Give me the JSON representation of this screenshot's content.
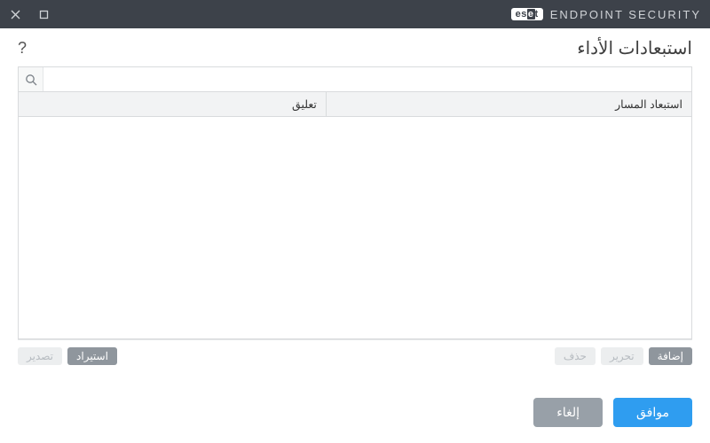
{
  "brand": {
    "badge_html": "eset",
    "product": "ENDPOINT SECURITY"
  },
  "page_title": "استبعادات الأداء",
  "search": {
    "placeholder": ""
  },
  "table": {
    "columns": {
      "path": "استبعاد المسار",
      "comment": "تعليق"
    },
    "rows": []
  },
  "mini_buttons": {
    "add": {
      "label": "إضافة",
      "enabled": true
    },
    "edit": {
      "label": "تحرير",
      "enabled": false
    },
    "del": {
      "label": "حذف",
      "enabled": false
    },
    "import": {
      "label": "استيراد",
      "enabled": true
    },
    "export": {
      "label": "تصدير",
      "enabled": false
    }
  },
  "footer": {
    "ok": "موافق",
    "cancel": "إلغاء"
  }
}
